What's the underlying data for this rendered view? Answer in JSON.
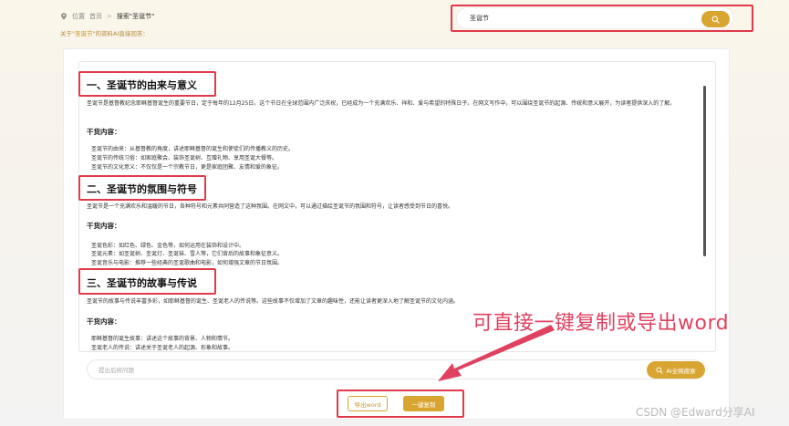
{
  "breadcrumb": {
    "location_label": "位置",
    "home": "首页",
    "separator": ">",
    "current": "搜索\"圣诞节\""
  },
  "subtitle": {
    "prefix": "关于\"",
    "keyword": "圣诞节",
    "suffix": "\"的资料AI直接回答："
  },
  "search": {
    "value": "圣诞节",
    "icon": "search-icon"
  },
  "article": {
    "sections": [
      {
        "heading": "一、圣诞节的由来与意义",
        "paragraph": "圣诞节是基督教纪念耶稣基督诞生的重要节日，定于每年的12月25日。这个节日在全球范围内广泛庆祝，已经成为一个充满欢乐、祥和、爱与希望的特殊日子。在网文写作中，可以围绕圣诞节的起源、传统和意义展开，为读者提供深入的了解。",
        "subheading": "干货内容：",
        "items": [
          "圣诞节的由来：从基督教的角度，讲述耶稣基督的诞生和使徒们的传播教义的历史。",
          "圣诞节的传统习俗：如家庭聚会、装饰圣诞树、互赠礼物、享用圣诞大餐等。",
          "圣诞节的文化意义：不仅仅是一个宗教节日，更是家庭团聚、友情和爱的象征。"
        ]
      },
      {
        "heading": "二、圣诞节的氛围与符号",
        "paragraph": "圣诞节是一个充满欢乐和温暖的节日，各种符号和元素共同营造了这种氛围。在网文中，可以通过描绘圣诞节的氛围和符号，让读者感受到节日的喜悦。",
        "subheading": "干货内容：",
        "items": [
          "圣诞色彩：如红色、绿色、金色等，如何运用在装饰和设计中。",
          "圣诞元素：如圣诞树、圣诞灯、圣诞袜、雪人等，它们背后的故事和象征意义。",
          "圣诞音乐与电影：推荐一些经典的圣诞歌曲和电影，如何增强文章的节日氛围。"
        ]
      },
      {
        "heading": "三、圣诞节的故事与传说",
        "paragraph": "圣诞节的故事与传说丰富多彩，如耶稣基督的诞生、圣诞老人的传说等。这些故事不仅增加了文章的趣味性，还能让读者更深入地了解圣诞节的文化内涵。",
        "subheading": "干货内容：",
        "items": [
          "耶稣基督的诞生故事：讲述这个故事的背景、人物和情节。",
          "圣诞老人的传说：讲述关于圣诞老人的起源、形象和故事。"
        ]
      }
    ]
  },
  "followup": {
    "placeholder": "提出后续问题",
    "ai_button": "AI全网搜索"
  },
  "actions": {
    "export_word": "导出word",
    "copy_all": "一键复制"
  },
  "annotation": "可直接一键复制或导出word",
  "watermark": "CSDN @Edward分享AI",
  "colors": {
    "accent": "#d9a531",
    "highlight_box": "#e03a4b",
    "annotation": "#e0415f"
  }
}
